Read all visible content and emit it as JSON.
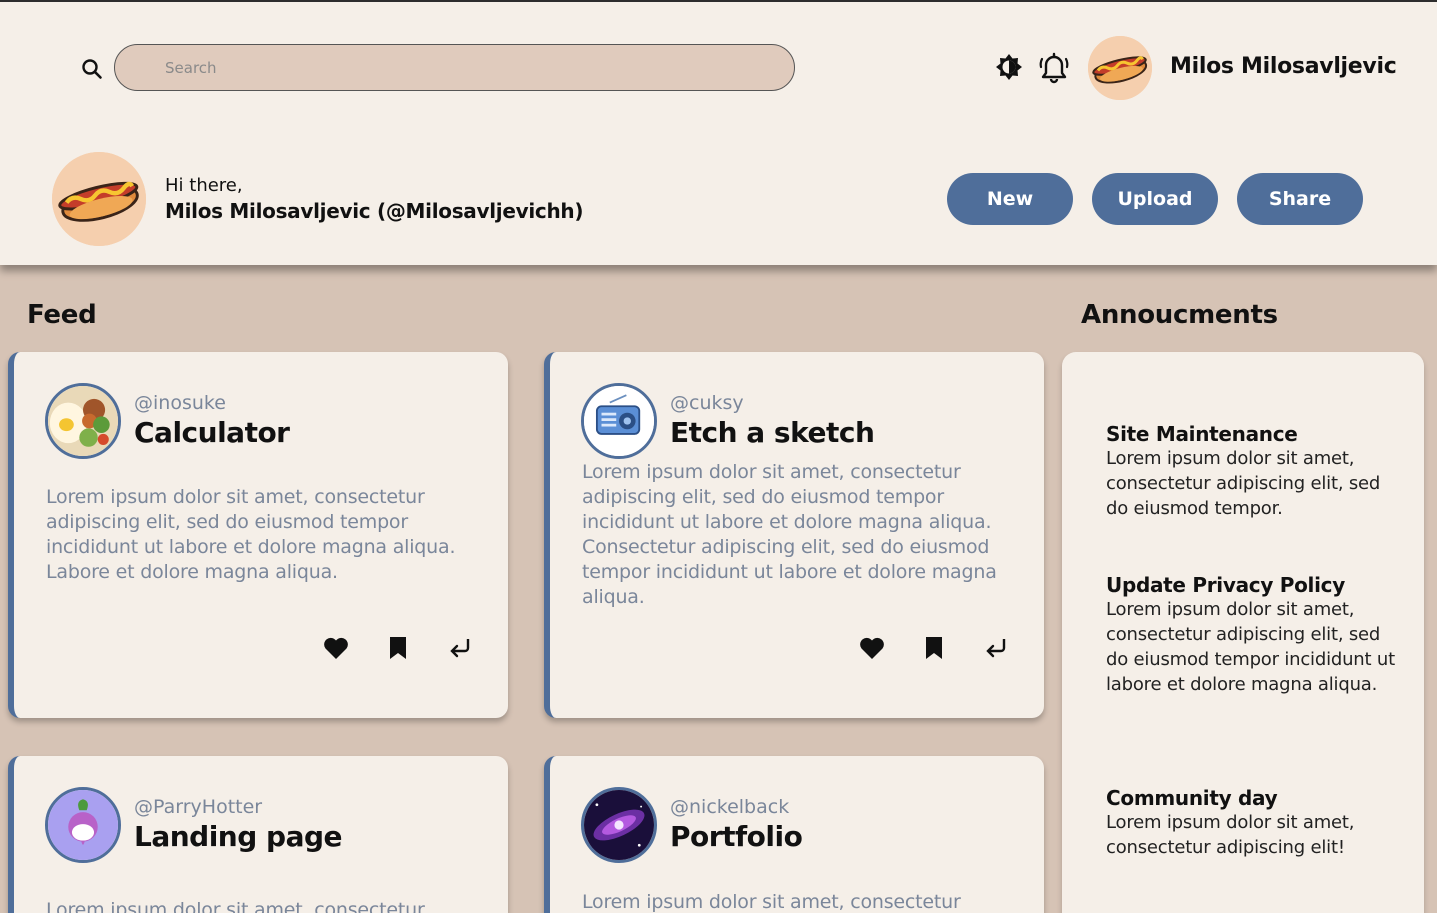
{
  "search": {
    "placeholder": "Search"
  },
  "user": {
    "name": "Milos Milosavljevic",
    "greeting": "Hi there,",
    "full_handle": "Milos Milosavljevic (@Milosavljevichh)"
  },
  "actions": {
    "new_label": "New",
    "upload_label": "Upload",
    "share_label": "Share"
  },
  "feed": {
    "title": "Feed",
    "cards": [
      {
        "handle": "@inosuke",
        "title": "Calculator",
        "body": "Lorem ipsum dolor sit amet, consectetur adipiscing elit, sed do eiusmod tempor incididunt ut labore et dolore magna aliqua. Labore et dolore magna aliqua.",
        "avatar": "food-bowl-icon"
      },
      {
        "handle": "@cuksy",
        "title": "Etch a sketch",
        "body": "Lorem ipsum dolor sit amet, consectetur adipiscing elit, sed do eiusmod tempor incididunt ut labore et dolore magna aliqua. Consectetur adipiscing elit, sed do eiusmod tempor incididunt ut labore et dolore magna aliqua.",
        "avatar": "radio-icon"
      },
      {
        "handle": "@ParryHotter",
        "title": "Landing page",
        "body": "Lorem ipsum dolor sit amet, consectetur",
        "avatar": "turnip-icon"
      },
      {
        "handle": "@nickelback",
        "title": "Portfolio",
        "body": "Lorem ipsum dolor sit amet, consectetur",
        "avatar": "galaxy-icon"
      }
    ]
  },
  "announcements": {
    "title": "Annoucments",
    "items": [
      {
        "title": "Site Maintenance",
        "text": "Lorem ipsum dolor sit amet, consectetur adipiscing elit, sed do eiusmod tempor."
      },
      {
        "title": "Update Privacy Policy",
        "text": "Lorem ipsum dolor sit amet, consectetur adipiscing elit, sed do eiusmod tempor incididunt ut labore et dolore magna aliqua."
      },
      {
        "title": "Community day",
        "text": "Lorem ipsum dolor sit amet, consectetur adipiscing elit!"
      }
    ]
  },
  "colors": {
    "accent": "#4f6e9a",
    "header_bg": "#f5efe8",
    "page_bg": "#d6c3b5",
    "search_bg": "#e0cbbd"
  }
}
